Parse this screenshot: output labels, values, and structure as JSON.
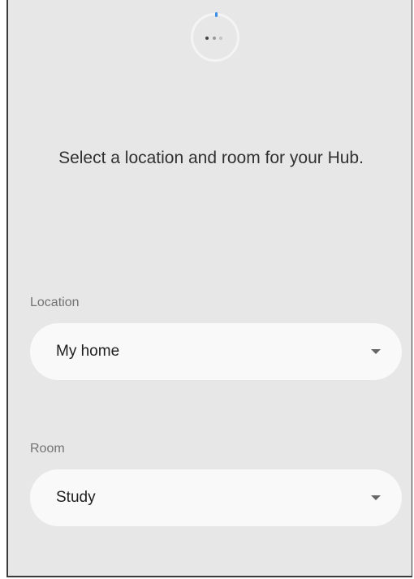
{
  "header": {
    "progress_icon": "loading-dots-icon",
    "accent_color": "#3a8ee6"
  },
  "main": {
    "title": "Select a location and room for your Hub.",
    "location": {
      "label": "Location",
      "value": "My home",
      "icon": "chevron-down-icon"
    },
    "room": {
      "label": "Room",
      "value": "Study",
      "icon": "chevron-down-icon"
    }
  },
  "colors": {
    "background": "#e7e7e7",
    "field": "#f9f9f9",
    "label": "#737373"
  }
}
